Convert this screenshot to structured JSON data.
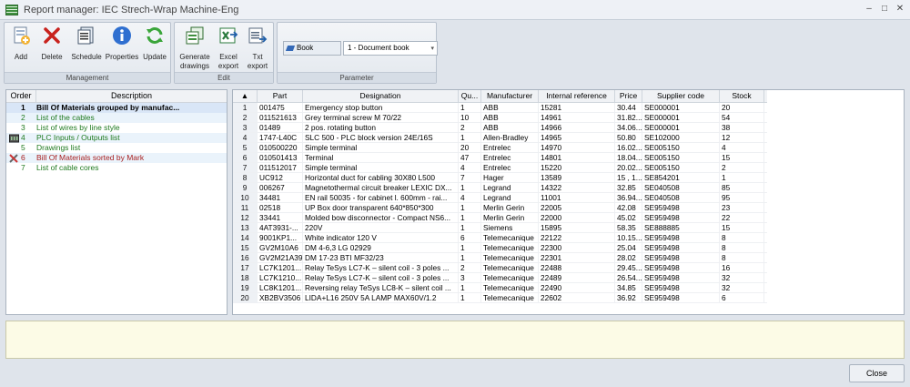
{
  "window": {
    "title": "Report manager: IEC Strech-Wrap Machine-Eng",
    "minimize": "–",
    "maximize": "□",
    "close": "✕"
  },
  "ribbon": {
    "management": {
      "label": "Management",
      "buttons": [
        {
          "label": "Add",
          "icon": "add-document-icon"
        },
        {
          "label": "Delete",
          "icon": "delete-x-icon"
        },
        {
          "label": "Schedule",
          "icon": "schedule-icon"
        },
        {
          "label": "Properties",
          "icon": "info-icon"
        },
        {
          "label": "Update",
          "icon": "refresh-icon"
        }
      ]
    },
    "edit": {
      "label": "Edit",
      "buttons": [
        {
          "label": "Generate\ndrawings",
          "icon": "generate-drawings-icon"
        },
        {
          "label": "Excel\nexport",
          "icon": "excel-export-icon"
        },
        {
          "label": "Txt\nexport",
          "icon": "txt-export-icon"
        }
      ]
    },
    "parameter": {
      "label": "Parameter",
      "book_label": "Book",
      "book_value": "1 - Document book"
    }
  },
  "reports": {
    "headers": {
      "order": "Order",
      "description": "Description"
    },
    "items": [
      {
        "order": "1",
        "description": "Bill Of Materials grouped by manufac...",
        "selected": true,
        "color": "black"
      },
      {
        "order": "2",
        "description": "List of the cables",
        "color": "green"
      },
      {
        "order": "3",
        "description": "List of wires by line style",
        "color": "green"
      },
      {
        "order": "4",
        "description": "PLC Inputs / Outputs list",
        "color": "green",
        "icon": "plc-icon"
      },
      {
        "order": "5",
        "description": "Drawings list",
        "color": "green"
      },
      {
        "order": "6",
        "description": "Bill Of Materials sorted by Mark",
        "color": "red",
        "icon": "tools-icon"
      },
      {
        "order": "7",
        "description": "List of cable cores",
        "color": "green"
      }
    ]
  },
  "grid": {
    "sort_indicator": "▲",
    "columns": [
      "Part",
      "Designation",
      "Qu...",
      "Manufacturer",
      "Internal reference",
      "Price",
      "Supplier code",
      "Stock"
    ],
    "rows": [
      [
        "1",
        "001475",
        "Emergency stop button",
        "1",
        "ABB",
        "15281",
        "30.44",
        "SE000001",
        "20"
      ],
      [
        "2",
        "011521613",
        "Grey terminal screw M 70/22",
        "10",
        "ABB",
        "14961",
        "31.82...",
        "SE000001",
        "54"
      ],
      [
        "3",
        "01489",
        "2 pos. rotating button",
        "2",
        "ABB",
        "14966",
        "34.06...",
        "SE000001",
        "38"
      ],
      [
        "4",
        "1747-L40C",
        "SLC 500 - PLC block version 24E/16S",
        "1",
        "Allen-Bradley",
        "14965",
        "50.80",
        "SE102000",
        "12"
      ],
      [
        "5",
        "010500220",
        "Simple terminal",
        "20",
        "Entrelec",
        "14970",
        "16.02...",
        "SE005150",
        "4"
      ],
      [
        "6",
        "010501413",
        "Terminal",
        "47",
        "Entrelec",
        "14801",
        "18.04...",
        "SE005150",
        "15"
      ],
      [
        "7",
        "011512017",
        "Simple terminal",
        "4",
        "Entrelec",
        "15220",
        "20.02...",
        "SE005150",
        "2"
      ],
      [
        "8",
        "UC912",
        "Horizontal duct for cabling 30X80 L500",
        "7",
        "Hager",
        "13589",
        "15 , 1...",
        "SE854201",
        "1"
      ],
      [
        "9",
        "006267",
        "Magnetothermal circuit breaker LEXIC DX...",
        "1",
        "Legrand",
        "14322",
        "32.85",
        "SE040508",
        "85"
      ],
      [
        "10",
        "34481",
        "EN rail 50035 - for cabinet l. 600mm - rai...",
        "4",
        "Legrand",
        "11001",
        "36.94...",
        "SE040508",
        "95"
      ],
      [
        "11",
        "02518",
        "UP Box door transparent 640*850*300",
        "1",
        "Merlin Gerin",
        "22005",
        "42.08",
        "SE959498",
        "23"
      ],
      [
        "12",
        "33441",
        "Molded bow disconnector - Compact NS6...",
        "1",
        "Merlin Gerin",
        "22000",
        "45.02",
        "SE959498",
        "22"
      ],
      [
        "13",
        "4AT3931-...",
        "220V",
        "1",
        "Siemens",
        "15895",
        "58.35",
        "SE888885",
        "15"
      ],
      [
        "14",
        "9001KP1...",
        "White indicator 120 V",
        "6",
        "Telemecanique",
        "22122",
        "10.15...",
        "SE959498",
        "8"
      ],
      [
        "15",
        "GV2M10A6",
        "DM 4-6,3 LG 02929",
        "1",
        "Telemecanique",
        "22300",
        "25.04",
        "SE959498",
        "8"
      ],
      [
        "16",
        "GV2M21A39",
        "DM 17-23 BTI MF32/23",
        "1",
        "Telemecanique",
        "22301",
        "28.02",
        "SE959498",
        "8"
      ],
      [
        "17",
        "LC7K1201...",
        "Relay TeSys LC7-K – silent coil - 3 poles ...",
        "2",
        "Telemecanique",
        "22488",
        "29.45...",
        "SE959498",
        "16"
      ],
      [
        "18",
        "LC7K1210...",
        "Relay TeSys LC7-K – silent coil - 3 poles ...",
        "3",
        "Telemecanique",
        "22489",
        "26.54...",
        "SE959498",
        "32"
      ],
      [
        "19",
        "LC8K1201...",
        "Reversing relay TeSys LC8-K – silent coil ...",
        "1",
        "Telemecanique",
        "22490",
        "34.85",
        "SE959498",
        "32"
      ],
      [
        "20",
        "XB2BV3506",
        "LIDA+L16 250V 5A LAMP MAX60V/1.2",
        "1",
        "Telemecanique",
        "22602",
        "36.92",
        "SE959498",
        "6"
      ]
    ]
  },
  "footer": {
    "close_label": "Close"
  }
}
